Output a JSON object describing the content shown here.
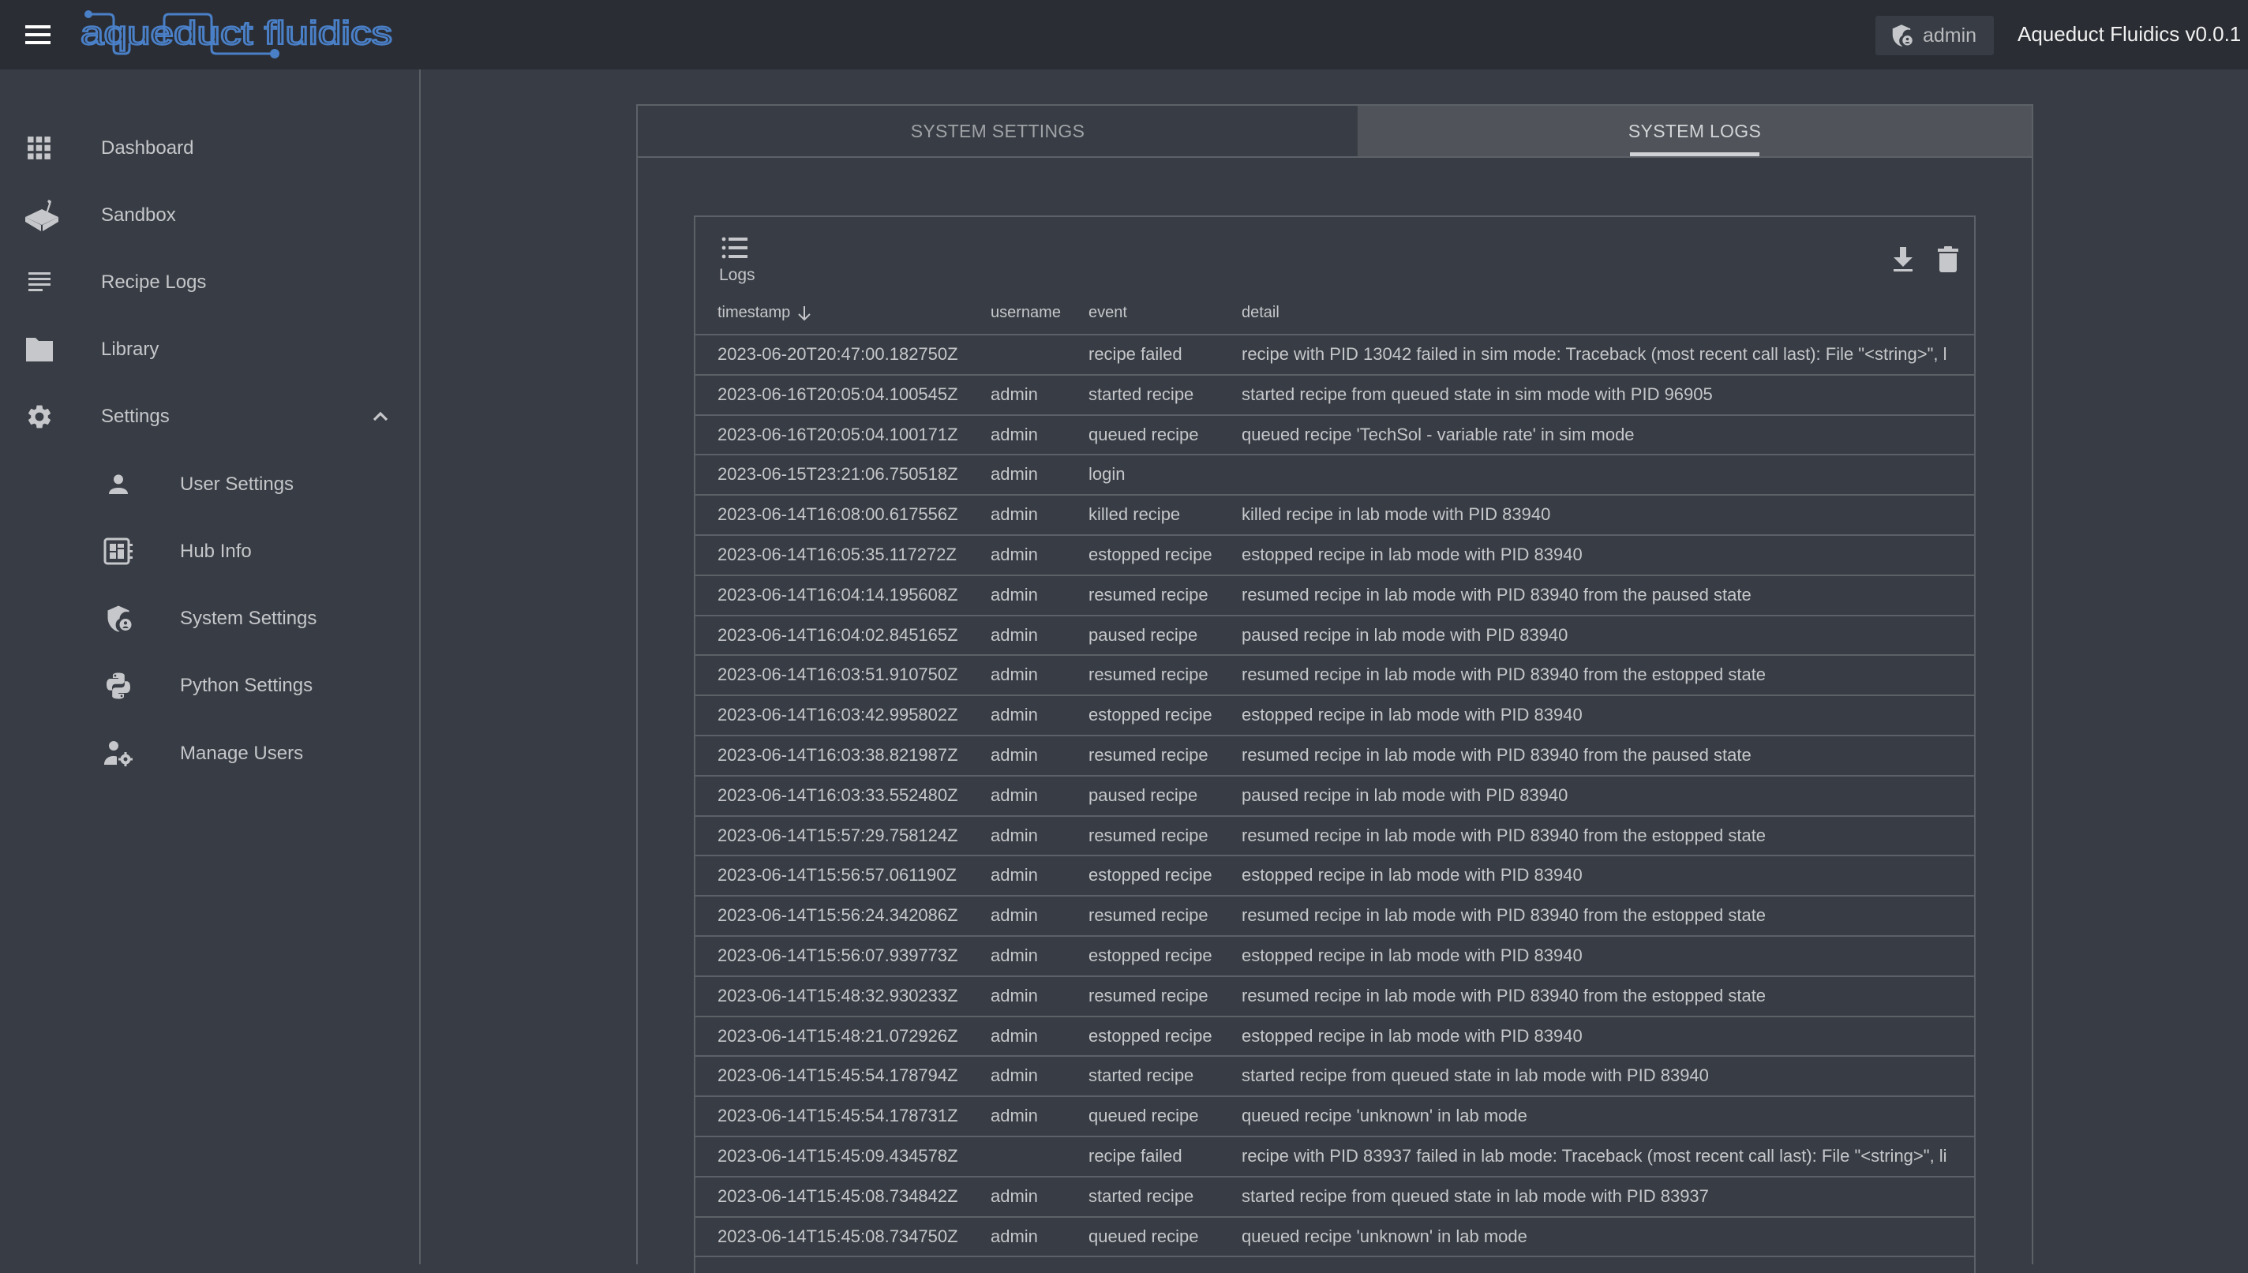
{
  "header": {
    "logo_text": "aqueduct fluidics",
    "user_label": "admin",
    "version": "Aqueduct Fluidics v0.0.1",
    "brand_color": "#4a80c8"
  },
  "sidebar": {
    "items": [
      {
        "label": "Dashboard",
        "icon": "grid-icon"
      },
      {
        "label": "Sandbox",
        "icon": "sandbox-icon"
      },
      {
        "label": "Recipe Logs",
        "icon": "notes-icon"
      },
      {
        "label": "Library",
        "icon": "folder-icon"
      },
      {
        "label": "Settings",
        "icon": "gear-icon",
        "expanded": true
      }
    ],
    "settings_items": [
      {
        "label": "User Settings",
        "icon": "person-icon"
      },
      {
        "label": "Hub Info",
        "icon": "hub-icon"
      },
      {
        "label": "System Settings",
        "icon": "admin-shield-icon"
      },
      {
        "label": "Python Settings",
        "icon": "python-icon"
      },
      {
        "label": "Manage Users",
        "icon": "manage-users-icon"
      }
    ]
  },
  "tabs": [
    {
      "label": "SYSTEM SETTINGS",
      "active": false
    },
    {
      "label": "SYSTEM LOGS",
      "active": true
    }
  ],
  "logs": {
    "title": "Logs",
    "columns": {
      "timestamp": "timestamp",
      "username": "username",
      "event": "event",
      "detail": "detail"
    },
    "sort": {
      "column": "timestamp",
      "direction": "desc",
      "icon": "arrow-down-icon"
    },
    "rows": [
      {
        "timestamp": "2023-06-20T20:47:00.182750Z",
        "username": "",
        "event": "recipe failed",
        "detail": "recipe with PID 13042 failed in sim mode: Traceback (most recent call last): File \"<string>\", l"
      },
      {
        "timestamp": "2023-06-16T20:05:04.100545Z",
        "username": "admin",
        "event": "started recipe",
        "detail": "started recipe from queued state in sim mode with PID 96905"
      },
      {
        "timestamp": "2023-06-16T20:05:04.100171Z",
        "username": "admin",
        "event": "queued recipe",
        "detail": "queued recipe 'TechSol - variable rate' in sim mode"
      },
      {
        "timestamp": "2023-06-15T23:21:06.750518Z",
        "username": "admin",
        "event": "login",
        "detail": ""
      },
      {
        "timestamp": "2023-06-14T16:08:00.617556Z",
        "username": "admin",
        "event": "killed recipe",
        "detail": "killed recipe in lab mode with PID 83940"
      },
      {
        "timestamp": "2023-06-14T16:05:35.117272Z",
        "username": "admin",
        "event": "estopped recipe",
        "detail": "estopped recipe in lab mode with PID 83940"
      },
      {
        "timestamp": "2023-06-14T16:04:14.195608Z",
        "username": "admin",
        "event": "resumed recipe",
        "detail": "resumed recipe in lab mode with PID 83940 from the paused state"
      },
      {
        "timestamp": "2023-06-14T16:04:02.845165Z",
        "username": "admin",
        "event": "paused recipe",
        "detail": "paused recipe in lab mode with PID 83940"
      },
      {
        "timestamp": "2023-06-14T16:03:51.910750Z",
        "username": "admin",
        "event": "resumed recipe",
        "detail": "resumed recipe in lab mode with PID 83940 from the estopped state"
      },
      {
        "timestamp": "2023-06-14T16:03:42.995802Z",
        "username": "admin",
        "event": "estopped recipe",
        "detail": "estopped recipe in lab mode with PID 83940"
      },
      {
        "timestamp": "2023-06-14T16:03:38.821987Z",
        "username": "admin",
        "event": "resumed recipe",
        "detail": "resumed recipe in lab mode with PID 83940 from the paused state"
      },
      {
        "timestamp": "2023-06-14T16:03:33.552480Z",
        "username": "admin",
        "event": "paused recipe",
        "detail": "paused recipe in lab mode with PID 83940"
      },
      {
        "timestamp": "2023-06-14T15:57:29.758124Z",
        "username": "admin",
        "event": "resumed recipe",
        "detail": "resumed recipe in lab mode with PID 83940 from the estopped state"
      },
      {
        "timestamp": "2023-06-14T15:56:57.061190Z",
        "username": "admin",
        "event": "estopped recipe",
        "detail": "estopped recipe in lab mode with PID 83940"
      },
      {
        "timestamp": "2023-06-14T15:56:24.342086Z",
        "username": "admin",
        "event": "resumed recipe",
        "detail": "resumed recipe in lab mode with PID 83940 from the estopped state"
      },
      {
        "timestamp": "2023-06-14T15:56:07.939773Z",
        "username": "admin",
        "event": "estopped recipe",
        "detail": "estopped recipe in lab mode with PID 83940"
      },
      {
        "timestamp": "2023-06-14T15:48:32.930233Z",
        "username": "admin",
        "event": "resumed recipe",
        "detail": "resumed recipe in lab mode with PID 83940 from the estopped state"
      },
      {
        "timestamp": "2023-06-14T15:48:21.072926Z",
        "username": "admin",
        "event": "estopped recipe",
        "detail": "estopped recipe in lab mode with PID 83940"
      },
      {
        "timestamp": "2023-06-14T15:45:54.178794Z",
        "username": "admin",
        "event": "started recipe",
        "detail": "started recipe from queued state in lab mode with PID 83940"
      },
      {
        "timestamp": "2023-06-14T15:45:54.178731Z",
        "username": "admin",
        "event": "queued recipe",
        "detail": "queued recipe 'unknown' in lab mode"
      },
      {
        "timestamp": "2023-06-14T15:45:09.434578Z",
        "username": "",
        "event": "recipe failed",
        "detail": "recipe with PID 83937 failed in lab mode: Traceback (most recent call last): File \"<string>\", li"
      },
      {
        "timestamp": "2023-06-14T15:45:08.734842Z",
        "username": "admin",
        "event": "started recipe",
        "detail": "started recipe from queued state in lab mode with PID 83937"
      },
      {
        "timestamp": "2023-06-14T15:45:08.734750Z",
        "username": "admin",
        "event": "queued recipe",
        "detail": "queued recipe 'unknown' in lab mode"
      }
    ]
  }
}
